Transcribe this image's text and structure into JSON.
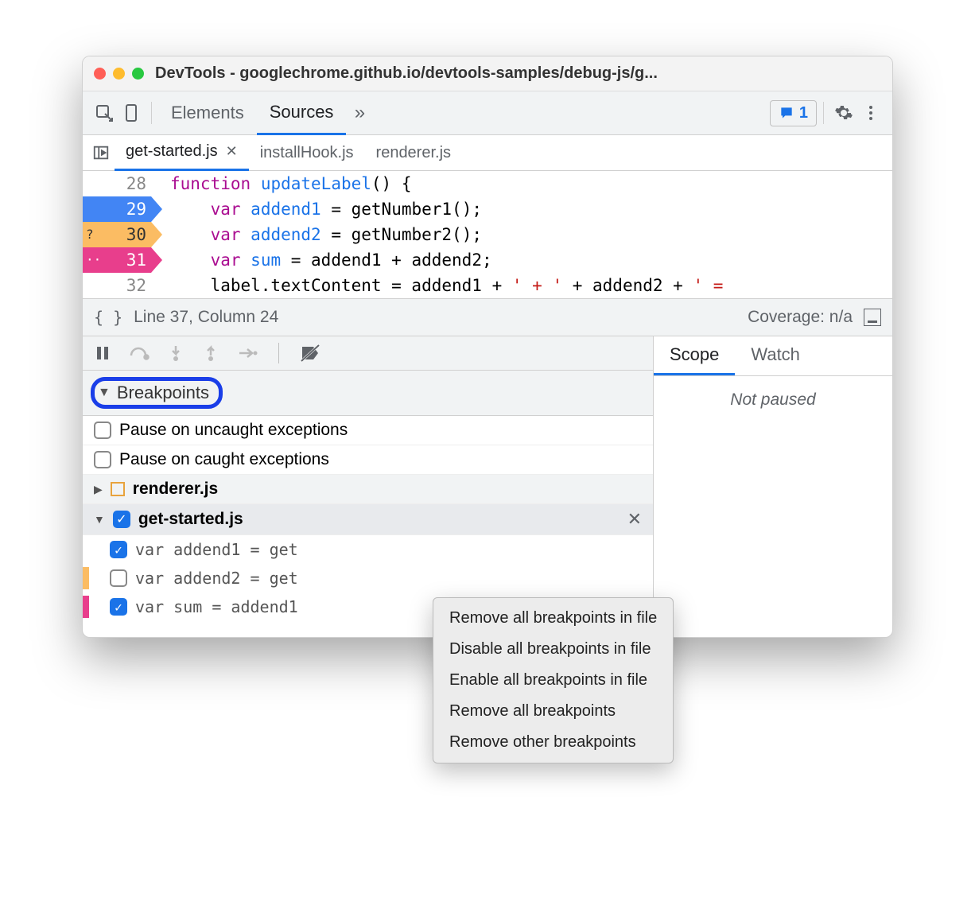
{
  "title": "DevTools - googlechrome.github.io/devtools-samples/debug-js/g...",
  "tabs": {
    "elements": "Elements",
    "sources": "Sources"
  },
  "messages_count": "1",
  "file_tabs": {
    "t0": "get-started.js",
    "t1": "installHook.js",
    "t2": "renderer.js"
  },
  "code": {
    "l28_num": "28",
    "l28": "function updateLabel() {",
    "l29_num": "29",
    "l29": "    var addend1 = getNumber1();",
    "l30_num": "30",
    "l30_badge": "?",
    "l30": "    var addend2 = getNumber2();",
    "l31_num": "31",
    "l31_badge": "··",
    "l31": "    var sum = addend1 + addend2;",
    "l32_num": "32",
    "l32_a": "    label.textContent = addend1 + ",
    "l32_s1": "' + '",
    "l32_b": " + addend2 + ",
    "l32_s2": "' ="
  },
  "status": {
    "pos": "Line 37, Column 24",
    "coverage": "Coverage: n/a"
  },
  "sections": {
    "breakpoints": "Breakpoints"
  },
  "bp": {
    "pause_uncaught": "Pause on uncaught exceptions",
    "pause_caught": "Pause on caught exceptions",
    "file_renderer": "renderer.js",
    "file_getstarted": "get-started.js",
    "item1": "var addend1 = get",
    "item2": "var addend2 = get",
    "item3": "var sum = addend1"
  },
  "right": {
    "scope": "Scope",
    "watch": "Watch",
    "not_paused": "Not paused"
  },
  "menu": {
    "m0": "Remove all breakpoints in file",
    "m1": "Disable all breakpoints in file",
    "m2": "Enable all breakpoints in file",
    "m3": "Remove all breakpoints",
    "m4": "Remove other breakpoints"
  }
}
